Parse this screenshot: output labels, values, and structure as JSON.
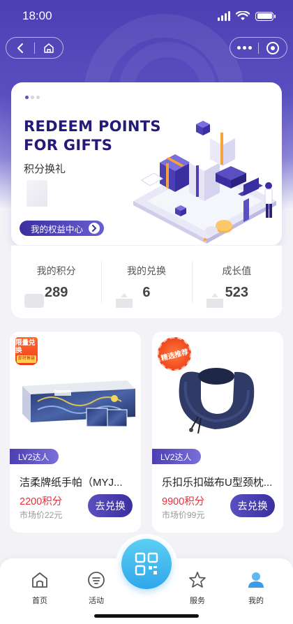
{
  "status_bar": {
    "time": "18:00"
  },
  "banner": {
    "title": "REDEEM POINTS FOR GIFTS",
    "subtitle": "积分换礼",
    "button_label": "我的权益中心",
    "active_slide": 1,
    "slide_count": 3
  },
  "stats": [
    {
      "label": "我的积分",
      "value": "289",
      "icon": "wallet-icon"
    },
    {
      "label": "我的兑换",
      "value": "6",
      "icon": "box-upload-icon"
    },
    {
      "label": "成长值",
      "value": "523",
      "icon": "box-upload-icon"
    }
  ],
  "products": [
    {
      "tag": "限量兑换",
      "tag_sub": "即将售罄",
      "level": "LV2达人",
      "name": "洁柔牌纸手帕（MYJ...",
      "points": "2200积分",
      "market_price": "市场价22元",
      "button": "去兑换"
    },
    {
      "tag": "精选推荐",
      "level": "LV2达人",
      "name": "乐扣乐扣磁布U型颈枕...",
      "points": "9900积分",
      "market_price": "市场价99元",
      "button": "去兑换"
    }
  ],
  "tabbar": {
    "items": [
      {
        "label": "首页",
        "icon": "home-icon",
        "active": false
      },
      {
        "label": "活动",
        "icon": "activity-icon",
        "active": false
      },
      {
        "label": "服务",
        "icon": "star-icon",
        "active": false
      },
      {
        "label": "我的",
        "icon": "user-icon",
        "active": true
      }
    ],
    "center_icon": "qr-code-icon"
  },
  "colors": {
    "brand_purple": "#4b3fb3",
    "points_red": "#e8303f",
    "fab_blue": "#2fa6ea",
    "tag_orange": "#f04a20"
  }
}
